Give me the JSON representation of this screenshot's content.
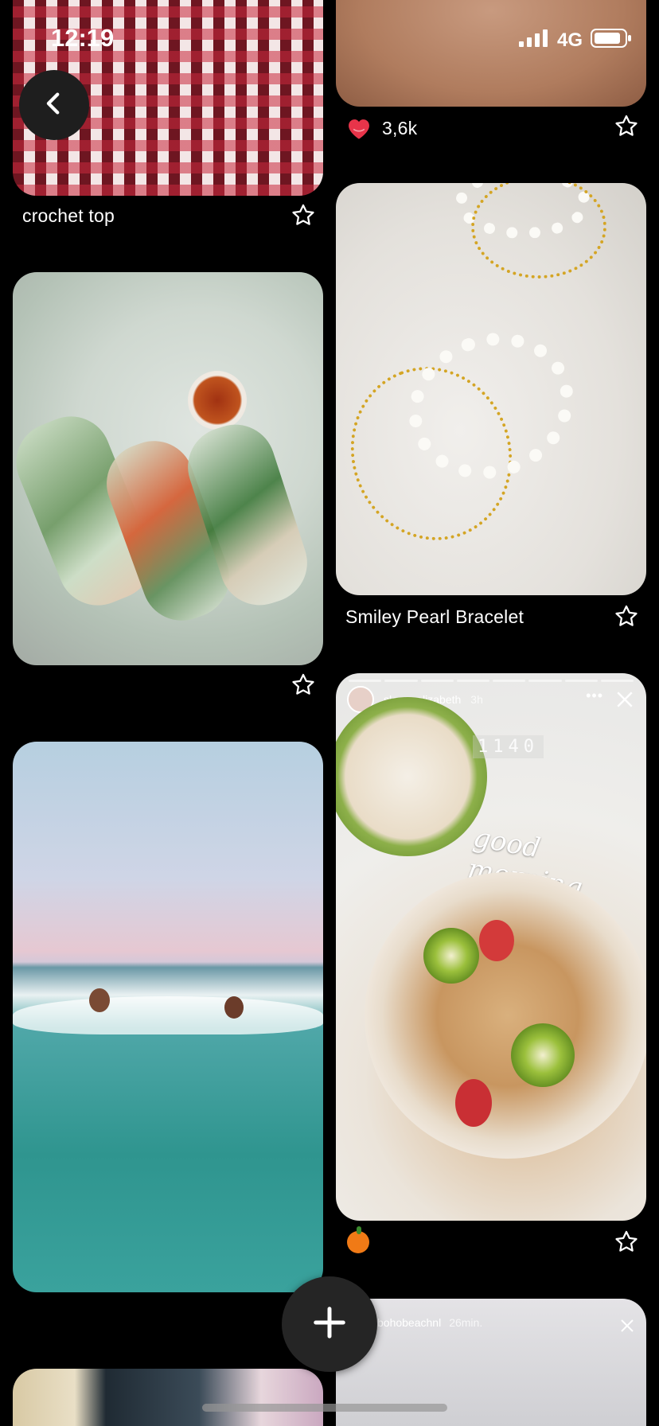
{
  "status_bar": {
    "time": "12:19",
    "network": "4G"
  },
  "pins": {
    "crochet": {
      "caption": "crochet top"
    },
    "skin": {
      "likes": "3,6k"
    },
    "rolls": {
      "caption": ""
    },
    "pearl": {
      "caption": "Smiley Pearl Bracelet"
    },
    "breakfast": {
      "story_user": "sloaneelizabeth",
      "story_time": "3h",
      "counter": "1140",
      "overlay_text": "good morning"
    },
    "beach": {
      "caption": ""
    },
    "bottom_right": {
      "story_user": "bohobeachnl",
      "story_time": "26min."
    }
  },
  "icons": {
    "back": "chevron-left-icon",
    "add": "plus-icon",
    "star": "star-outline-icon",
    "heart": "heart-icon"
  },
  "colors": {
    "background": "#000000",
    "heart": "#e8344a",
    "fab": "#252525"
  }
}
